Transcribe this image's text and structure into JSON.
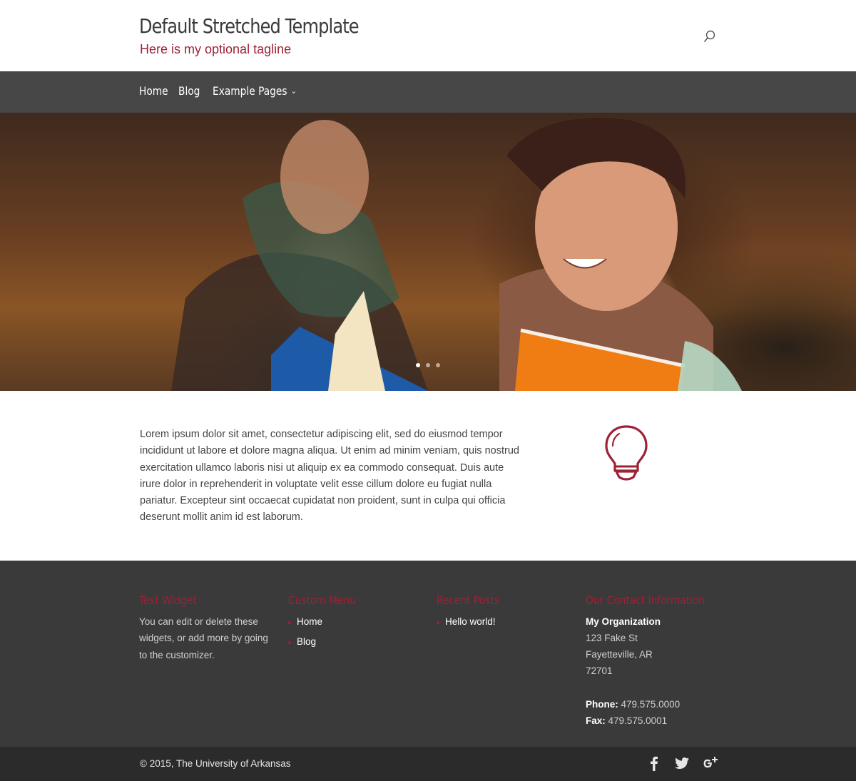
{
  "header": {
    "site_title": "Default Stretched Template",
    "tagline": "Here is my optional tagline",
    "search_icon": "search-icon"
  },
  "nav": {
    "items": [
      {
        "label": "Home"
      },
      {
        "label": "Blog"
      },
      {
        "label": "Example Pages",
        "has_dropdown": true
      }
    ]
  },
  "hero": {
    "slides_total": 3,
    "active_slide": 1
  },
  "main": {
    "body_text": "Lorem ipsum dolor sit amet, consectetur adipiscing elit, sed do eiusmod tempor incididunt ut labore et dolore magna aliqua. Ut enim ad minim veniam, quis nostrud exercitation ullamco laboris nisi ut aliquip ex ea commodo consequat. Duis aute irure dolor in reprehenderit in voluptate velit esse cillum dolore eu fugiat nulla pariatur. Excepteur sint occaecat cupidatat non proident, sunt in culpa qui officia deserunt mollit anim id est laborum.",
    "feature_icon": "lightbulb-icon"
  },
  "footer": {
    "text_widget": {
      "title": "Text Widget",
      "text": "You can edit or delete these widgets, or add more by going to the customizer."
    },
    "custom_menu": {
      "title": "Custom Menu",
      "items": [
        "Home",
        "Blog"
      ]
    },
    "recent_posts": {
      "title": "Recent Posts",
      "items": [
        "Hello world!"
      ]
    },
    "contact": {
      "title": "Our Contact Information",
      "organization": "My Organization",
      "street": "123 Fake St",
      "city": "Fayetteville, AR",
      "zip": "72701",
      "phone_label": "Phone:",
      "phone": "479.575.0000",
      "fax_label": "Fax:",
      "fax": "479.575.0001"
    }
  },
  "bottom": {
    "copyright": "© 2015, The University of Arkansas",
    "social": [
      "facebook-icon",
      "twitter-icon",
      "google-plus-icon"
    ]
  },
  "colors": {
    "accent": "#9d2235",
    "nav_bg": "#474747",
    "footer_bg": "#3a3a3a",
    "bottom_bg": "#2b2b2b"
  }
}
